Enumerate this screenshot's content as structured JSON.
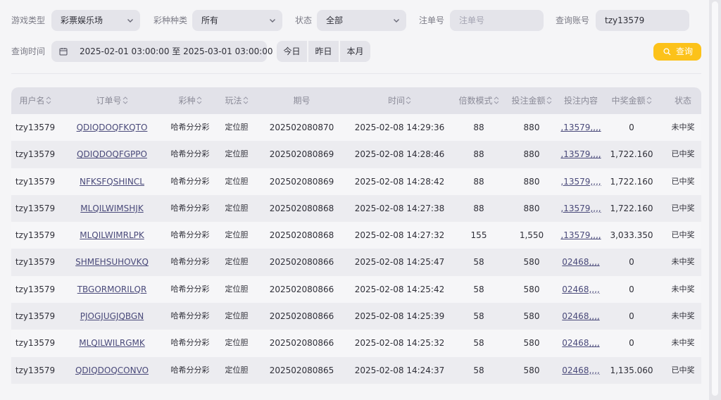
{
  "filters": {
    "game_type_label": "游戏类型",
    "game_type_value": "彩票娱乐场",
    "lottery_label": "彩种种类",
    "lottery_value": "所有",
    "status_label": "状态",
    "status_value": "全部",
    "order_label": "注单号",
    "order_placeholder": "注单号",
    "account_label": "查询账号",
    "account_value": "tzy13579",
    "time_label": "查询时间",
    "date_range": "2025-02-01 03:00:00 至 2025-03-01 03:00:00",
    "today": "今日",
    "yesterday": "昨日",
    "this_month": "本月",
    "search": "查询"
  },
  "colors": {
    "accent": "#fcc21a",
    "header_bg": "#e2e2e9"
  },
  "table": {
    "headers": [
      "用户名",
      "订单号",
      "彩种",
      "玩法",
      "期号",
      "时间",
      "倍数模式",
      "投注金额",
      "投注内容",
      "中奖金额",
      "状态"
    ],
    "rows": [
      [
        "tzy13579",
        "QDIQDOQFKQTO",
        "哈希分分彩",
        "定位胆",
        "202502080870",
        "2025-02-08 14:29:36",
        "88",
        "880",
        ",13579,,,,",
        "0",
        "未中奖"
      ],
      [
        "tzy13579",
        "QDIQDOQFGPPO",
        "哈希分分彩",
        "定位胆",
        "202502080869",
        "2025-02-08 14:28:46",
        "88",
        "880",
        ",13579,,,,",
        "1,722.160",
        "已中奖"
      ],
      [
        "tzy13579",
        "NFKSFQSHINCL",
        "哈希分分彩",
        "定位胆",
        "202502080869",
        "2025-02-08 14:28:42",
        "88",
        "880",
        ",13579,,,,",
        "1,722.160",
        "已中奖"
      ],
      [
        "tzy13579",
        "MLQILWIMSHJK",
        "哈希分分彩",
        "定位胆",
        "202502080868",
        "2025-02-08 14:27:38",
        "88",
        "880",
        ",13579,,,,",
        "1,722.160",
        "已中奖"
      ],
      [
        "tzy13579",
        "MLQILWIMRLPK",
        "哈希分分彩",
        "定位胆",
        "202502080868",
        "2025-02-08 14:27:32",
        "155",
        "1,550",
        ",13579,,,,",
        "3,033.350",
        "已中奖"
      ],
      [
        "tzy13579",
        "SHMEHSUHOVKQ",
        "哈希分分彩",
        "定位胆",
        "202502080866",
        "2025-02-08 14:25:47",
        "58",
        "580",
        "02468,,,,",
        "0",
        "未中奖"
      ],
      [
        "tzy13579",
        "TBGORMORILQR",
        "哈希分分彩",
        "定位胆",
        "202502080866",
        "2025-02-08 14:25:42",
        "58",
        "580",
        "02468,,,,",
        "0",
        "未中奖"
      ],
      [
        "tzy13579",
        "PJOGJUGJQBGN",
        "哈希分分彩",
        "定位胆",
        "202502080866",
        "2025-02-08 14:25:39",
        "58",
        "580",
        "02468,,,,",
        "0",
        "未中奖"
      ],
      [
        "tzy13579",
        "MLQILWILRGMK",
        "哈希分分彩",
        "定位胆",
        "202502080866",
        "2025-02-08 14:25:32",
        "58",
        "580",
        "02468,,,,",
        "0",
        "未中奖"
      ],
      [
        "tzy13579",
        "QDIQDOQCONVO",
        "哈希分分彩",
        "定位胆",
        "202502080865",
        "2025-02-08 14:24:37",
        "58",
        "580",
        "02468,,,,",
        "1,135.060",
        "已中奖"
      ]
    ]
  }
}
